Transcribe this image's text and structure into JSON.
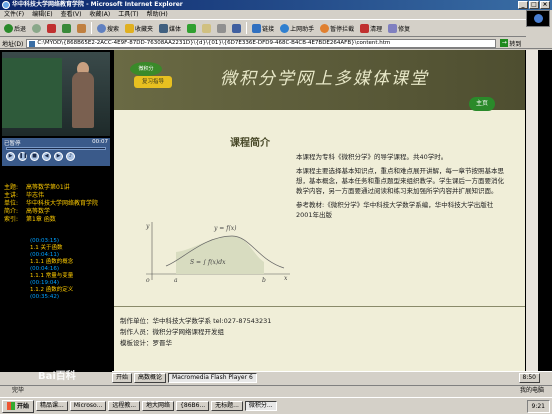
{
  "window": {
    "title": "华中科技大学网络教育学院 - Microsoft Internet Explorer"
  },
  "menu": [
    "文件(F)",
    "编辑(E)",
    "查看(V)",
    "收藏(A)",
    "工具(T)",
    "帮助(H)"
  ],
  "toolbar": {
    "back": "后退",
    "search": "搜索",
    "favorites": "收藏夹",
    "media": "媒体",
    "links": "链接",
    "upload": "上网助手",
    "pause": "暂停拦截",
    "clean": "清理",
    "repair": "修复"
  },
  "address": {
    "label": "地址(D)",
    "url": "C:\\MYOD\\{868B65E2-2ACC-4E9F-87DD-76308AA2231D}\\{d}\\{01}\\{6D7E336E-DFD9-468C-B4CB-4E7BDE264AFB}\\content.htm",
    "go": "转到"
  },
  "player": {
    "status": "已暂停",
    "time": "00:07"
  },
  "info": [
    {
      "k": "主题:",
      "v": "高等数学第01讲"
    },
    {
      "k": "主讲:",
      "v": "毕志伟"
    },
    {
      "k": "单位:",
      "v": "华中科技大学网络教育学院"
    },
    {
      "k": "简介:",
      "v": "高等数学"
    },
    {
      "k": "索引:",
      "v": "第1章 函数"
    }
  ],
  "outline": [
    {
      "label": "(00:03:15)",
      "type": "time"
    },
    {
      "label": "1.1 关于函数",
      "type": "item"
    },
    {
      "label": "(00:04:11)",
      "type": "time"
    },
    {
      "label": "1.1.1 函数的概念",
      "type": "item"
    },
    {
      "label": "(00:04:16)",
      "type": "time"
    },
    {
      "label": "1.1.1 常量与变量",
      "type": "item"
    },
    {
      "label": "(00:19:04)",
      "type": "time"
    },
    {
      "label": "1.1.2 函数的定义",
      "type": "item"
    },
    {
      "label": "(00:35:42)",
      "type": "time"
    }
  ],
  "flash": {
    "emblem_top": "微积分",
    "emblem_bottom": "复习指导",
    "title": "微积分学网上多媒体课堂",
    "home": "主页",
    "section": "课程简介",
    "paragraphs": [
      "本课程为专科《微积分学》的导学课程。共40学时。",
      "本课程主要选择基本知识点，重点和难点展开讲解，每一章节按照基本思想，基本概念，基本任务和重点题型来组织教学。学生课后一方面要消化教学内容，另一方面要通过阅读和练习来加强所学内容并扩展知识面。",
      "参考教材:《微积分学》华中科技大学数学系编，华中科技大学出版社2001年出版"
    ],
    "graph": {
      "fx": "y = f(x)",
      "integral": "S = ∫ f(x)dx",
      "y": "y",
      "x": "x",
      "o": "o",
      "a": "a",
      "b": "b"
    },
    "footer": [
      "制作单位：华中科技大学数学系   tel:027-87543231",
      "制作人员：微积分学网络课程开发组",
      "模板设计：罗晋华"
    ]
  },
  "inner_taskbar": [
    {
      "label": "开始",
      "active": false
    },
    {
      "label": "高数概论",
      "active": false
    },
    {
      "label": "Macromedia Flash Player 6",
      "active": true
    },
    {
      "label": "8:50",
      "active": false
    }
  ],
  "status": {
    "left": "完毕",
    "right": "我的电脑"
  },
  "taskbar": {
    "start": "开始",
    "items": [
      "精品课...",
      "Microso...",
      "远程教...",
      "地大网络",
      "{86B6...",
      "无标题...",
      "微积分..."
    ],
    "clock": "9:21"
  },
  "watermark": "Bai百科"
}
